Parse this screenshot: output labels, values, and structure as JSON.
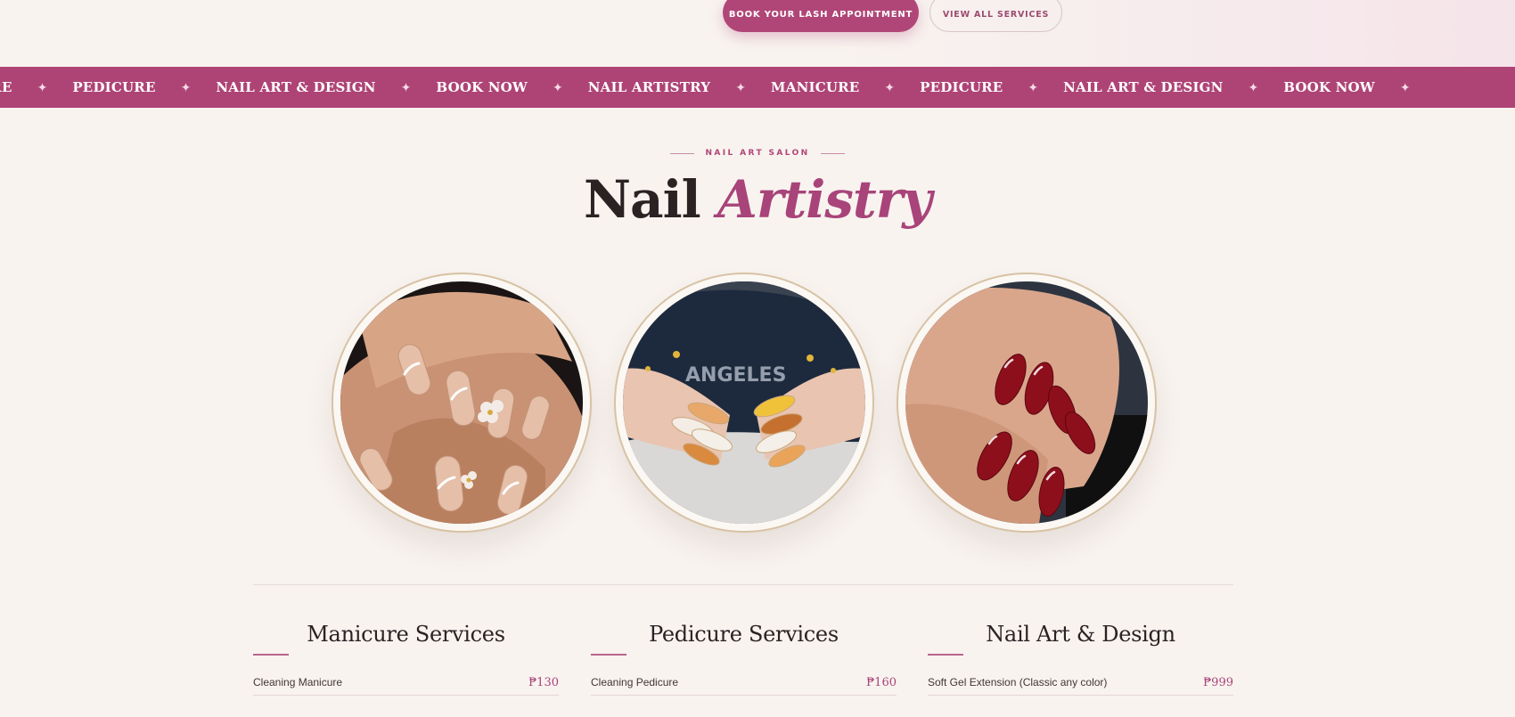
{
  "hero": {
    "book_button": "BOOK YOUR LASH APPOINTMENT",
    "view_all_button": "VIEW ALL SERVICES"
  },
  "marquee": {
    "items": [
      "URE",
      "PEDICURE",
      "NAIL ART & DESIGN",
      "BOOK NOW",
      "NAIL ARTISTRY",
      "MANICURE",
      "PEDICURE",
      "NAIL ART & DESIGN",
      "BOOK NOW"
    ],
    "separator": "✦"
  },
  "section": {
    "eyebrow": "NAIL ART SALON",
    "title_main": "Nail",
    "title_accent": "Artistry"
  },
  "gallery": {
    "photos": [
      {
        "icon": "nude-floral-nails-photo"
      },
      {
        "icon": "tortoiseshell-gold-nails-photo"
      },
      {
        "icon": "red-chrome-nails-photo"
      }
    ]
  },
  "services": [
    {
      "heading": "Manicure Services",
      "items": [
        {
          "name": "Cleaning Manicure",
          "price": "₱130"
        }
      ]
    },
    {
      "heading": "Pedicure Services",
      "items": [
        {
          "name": "Cleaning Pedicure",
          "price": "₱160"
        }
      ]
    },
    {
      "heading": "Nail Art & Design",
      "items": [
        {
          "name": "Soft Gel Extension (Classic any color)",
          "price": "₱999"
        }
      ]
    }
  ],
  "colors": {
    "brand": "#ae4476",
    "background": "#f8f3ef",
    "heading": "#2b2224",
    "ring": "#d8c2a4"
  }
}
